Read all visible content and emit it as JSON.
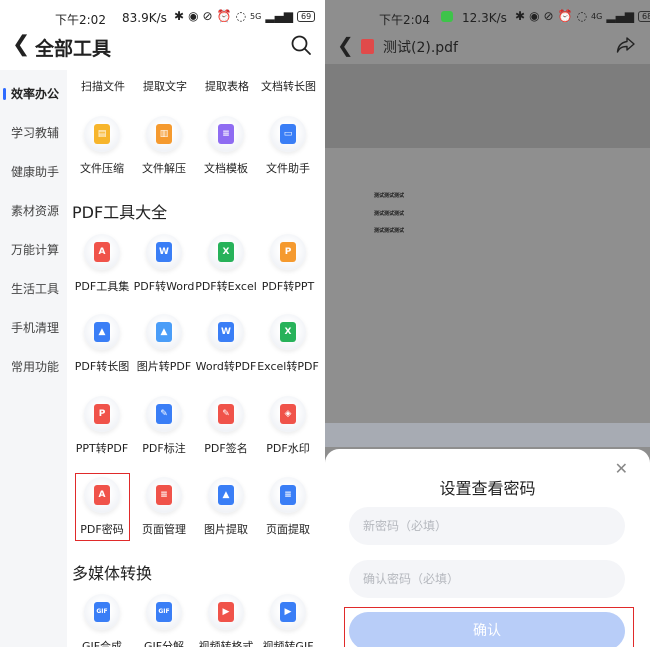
{
  "left_status": {
    "time": "下午2:02",
    "speed": "83.9K/s",
    "signal": "5G",
    "battery": "69"
  },
  "left_header": {
    "title": "全部工具"
  },
  "sidebar": {
    "items": [
      "效率办公",
      "学习教辅",
      "健康助手",
      "素材资源",
      "万能计算",
      "生活工具",
      "手机清理",
      "常用功能"
    ],
    "active": "效率办公"
  },
  "top_partial_tools": [
    "扫描文件",
    "提取文字",
    "提取表格",
    "文档转长图"
  ],
  "efficiency_tools": [
    {
      "label": "文件压缩",
      "icon": "zip-icon",
      "color": "#f7b52c"
    },
    {
      "label": "文件解压",
      "icon": "unzip-icon",
      "color": "#f59a2f"
    },
    {
      "label": "文档模板",
      "icon": "template-icon",
      "color": "#8f6cf2"
    },
    {
      "label": "文件助手",
      "icon": "folder-icon",
      "color": "#3a7ef6"
    }
  ],
  "pdf_section": {
    "title": "PDF工具大全",
    "tools": [
      {
        "label": "PDF工具集",
        "icon": "pdf-icon",
        "color": "#f0534a"
      },
      {
        "label": "PDF转Word",
        "icon": "pdf-to-word-icon",
        "color": "#3a7ef6"
      },
      {
        "label": "PDF转Excel",
        "icon": "pdf-to-excel-icon",
        "color": "#27b25a"
      },
      {
        "label": "PDF转PPT",
        "icon": "pdf-to-ppt-icon",
        "color": "#f59a2f"
      },
      {
        "label": "PDF转长图",
        "icon": "pdf-to-image-icon",
        "color": "#3a7ef6"
      },
      {
        "label": "图片转PDF",
        "icon": "image-to-pdf-icon",
        "color": "#4a9df8"
      },
      {
        "label": "Word转PDF",
        "icon": "word-to-pdf-icon",
        "color": "#3a7ef6"
      },
      {
        "label": "Excel转PDF",
        "icon": "excel-to-pdf-icon",
        "color": "#27b25a"
      },
      {
        "label": "PPT转PDF",
        "icon": "ppt-to-pdf-icon",
        "color": "#f0534a"
      },
      {
        "label": "PDF标注",
        "icon": "annotate-icon",
        "color": "#3a7ef6"
      },
      {
        "label": "PDF签名",
        "icon": "signature-icon",
        "color": "#f0534a"
      },
      {
        "label": "PDF水印",
        "icon": "watermark-icon",
        "color": "#f0534a"
      },
      {
        "label": "PDF密码",
        "icon": "lock-icon",
        "color": "#f0534a"
      },
      {
        "label": "页面管理",
        "icon": "page-manage-icon",
        "color": "#f0534a"
      },
      {
        "label": "图片提取",
        "icon": "image-extract-icon",
        "color": "#3a7ef6"
      },
      {
        "label": "页面提取",
        "icon": "page-extract-icon",
        "color": "#3a7ef6"
      }
    ]
  },
  "media_section": {
    "title": "多媒体转换",
    "tools": [
      {
        "label": "GIF合成",
        "icon": "gif-icon",
        "color": "#3a7ef6"
      },
      {
        "label": "GIF分解",
        "icon": "gif-split-icon",
        "color": "#3a7ef6"
      },
      {
        "label": "视频转格式",
        "icon": "video-convert-icon",
        "color": "#f0534a"
      },
      {
        "label": "视频转GIF",
        "icon": "video-gif-icon",
        "color": "#3a7ef6"
      }
    ]
  },
  "right_status": {
    "time": "下午2:04",
    "speed": "12.3K/s",
    "signal": "4G",
    "battery": "68"
  },
  "pdf_viewer": {
    "file_name": "测试(2).pdf",
    "lines": [
      "测试测试测试",
      "测试测试测试",
      "测试测试测试"
    ]
  },
  "password_dialog": {
    "title": "设置查看密码",
    "new_password_placeholder": "新密码（必填）",
    "confirm_password_placeholder": "确认密码（必填）",
    "confirm_label": "确认"
  }
}
